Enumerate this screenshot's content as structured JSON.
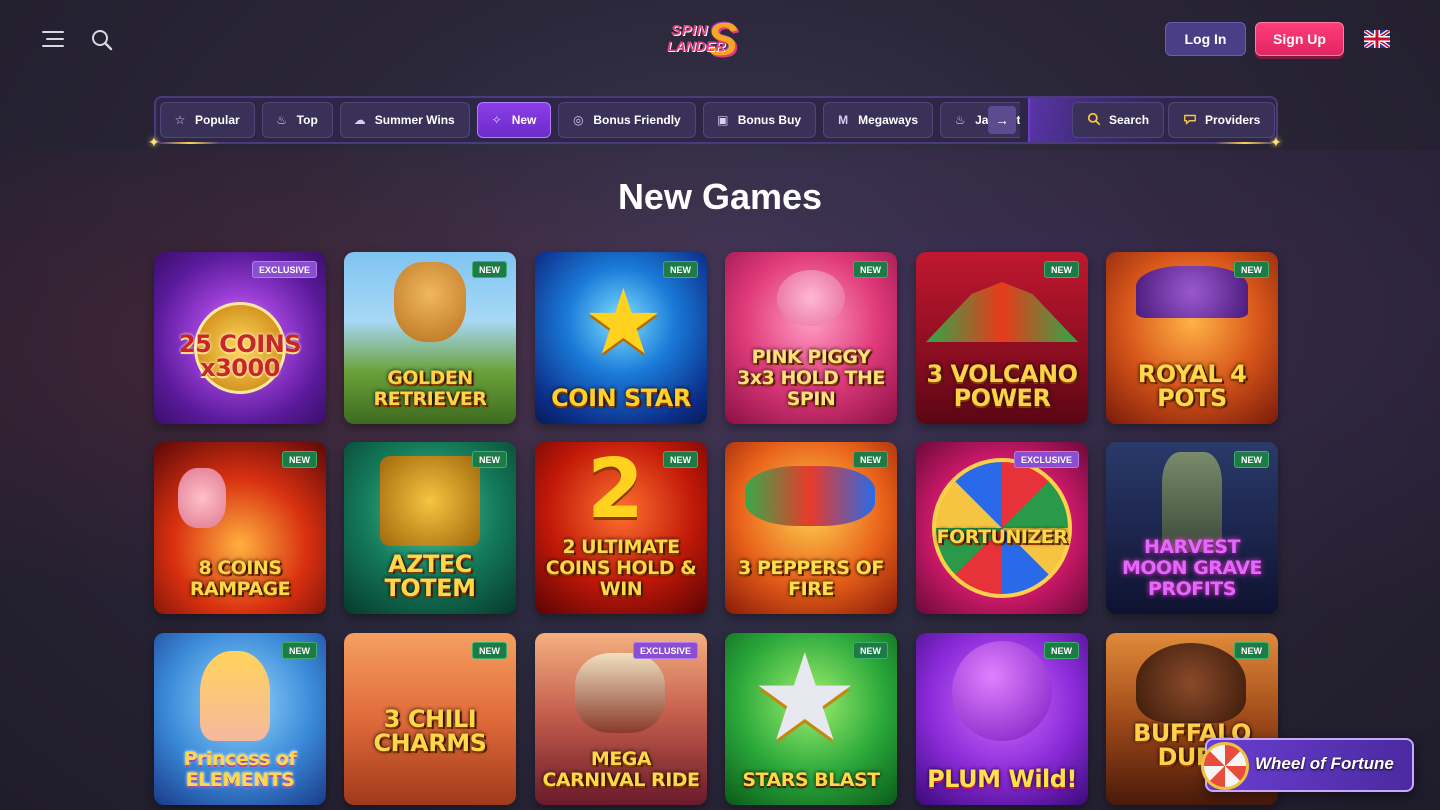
{
  "header": {
    "logo_line1": "SPIN",
    "logo_line2": "LANDER",
    "logo_mark": "S",
    "login_label": "Log In",
    "signup_label": "Sign Up",
    "menu_icon": "hamburger-icon",
    "search_icon": "search-icon",
    "language_icon": "uk-flag-icon"
  },
  "nav": {
    "tabs": [
      {
        "label": "Popular",
        "icon": "☆"
      },
      {
        "label": "Top",
        "icon": "♨"
      },
      {
        "label": "Summer Wins",
        "icon": "☁"
      },
      {
        "label": "New",
        "icon": "✧",
        "active": true
      },
      {
        "label": "Bonus Friendly",
        "icon": "◎"
      },
      {
        "label": "Bonus Buy",
        "icon": "▣"
      },
      {
        "label": "Megaways",
        "icon": "M"
      },
      {
        "label": "Jackpot",
        "icon": "♨"
      }
    ],
    "arrow": "→",
    "search_label": "Search",
    "providers_label": "Providers"
  },
  "page_title": "New Games",
  "games": [
    {
      "title": "25 COINS x3000",
      "badge": "EXCLUSIVE"
    },
    {
      "title": "GOLDEN RETRIEVER",
      "badge": "NEW"
    },
    {
      "title": "COIN STAR",
      "badge": "NEW"
    },
    {
      "title": "PINK PIGGY 3x3 HOLD THE SPIN",
      "badge": "NEW"
    },
    {
      "title": "3 VOLCANO POWER",
      "badge": "NEW"
    },
    {
      "title": "ROYAL 4 POTS",
      "badge": "NEW"
    },
    {
      "title": "8 COINS RAMPAGE",
      "badge": "NEW"
    },
    {
      "title": "AZTEC TOTEM",
      "badge": "NEW"
    },
    {
      "title": "2 ULTIMATE COINS HOLD & WIN",
      "badge": "NEW"
    },
    {
      "title": "3 PEPPERS OF FIRE",
      "badge": "NEW"
    },
    {
      "title": "FORTUNIZER",
      "badge": "EXCLUSIVE"
    },
    {
      "title": "HARVEST MOON GRAVE PROFITS",
      "badge": "NEW"
    },
    {
      "title": "Princess of ELEMENTS",
      "badge": "NEW"
    },
    {
      "title": "3 CHILI CHARMS",
      "badge": "NEW"
    },
    {
      "title": "MEGA CARNIVAL RIDE",
      "badge": "EXCLUSIVE"
    },
    {
      "title": "STARS BLAST",
      "badge": "NEW"
    },
    {
      "title": "PLUM Wild!",
      "badge": "NEW"
    },
    {
      "title": "BUFFALO DUEL",
      "badge": "NEW"
    }
  ],
  "wheel_of_fortune_label": "Wheel of Fortune",
  "colors": {
    "accent_purple": "#8a3ee8",
    "signup_pink": "#ff3d7a",
    "badge_new": "#1e7a46",
    "badge_exclusive": "#8a4ed0"
  }
}
